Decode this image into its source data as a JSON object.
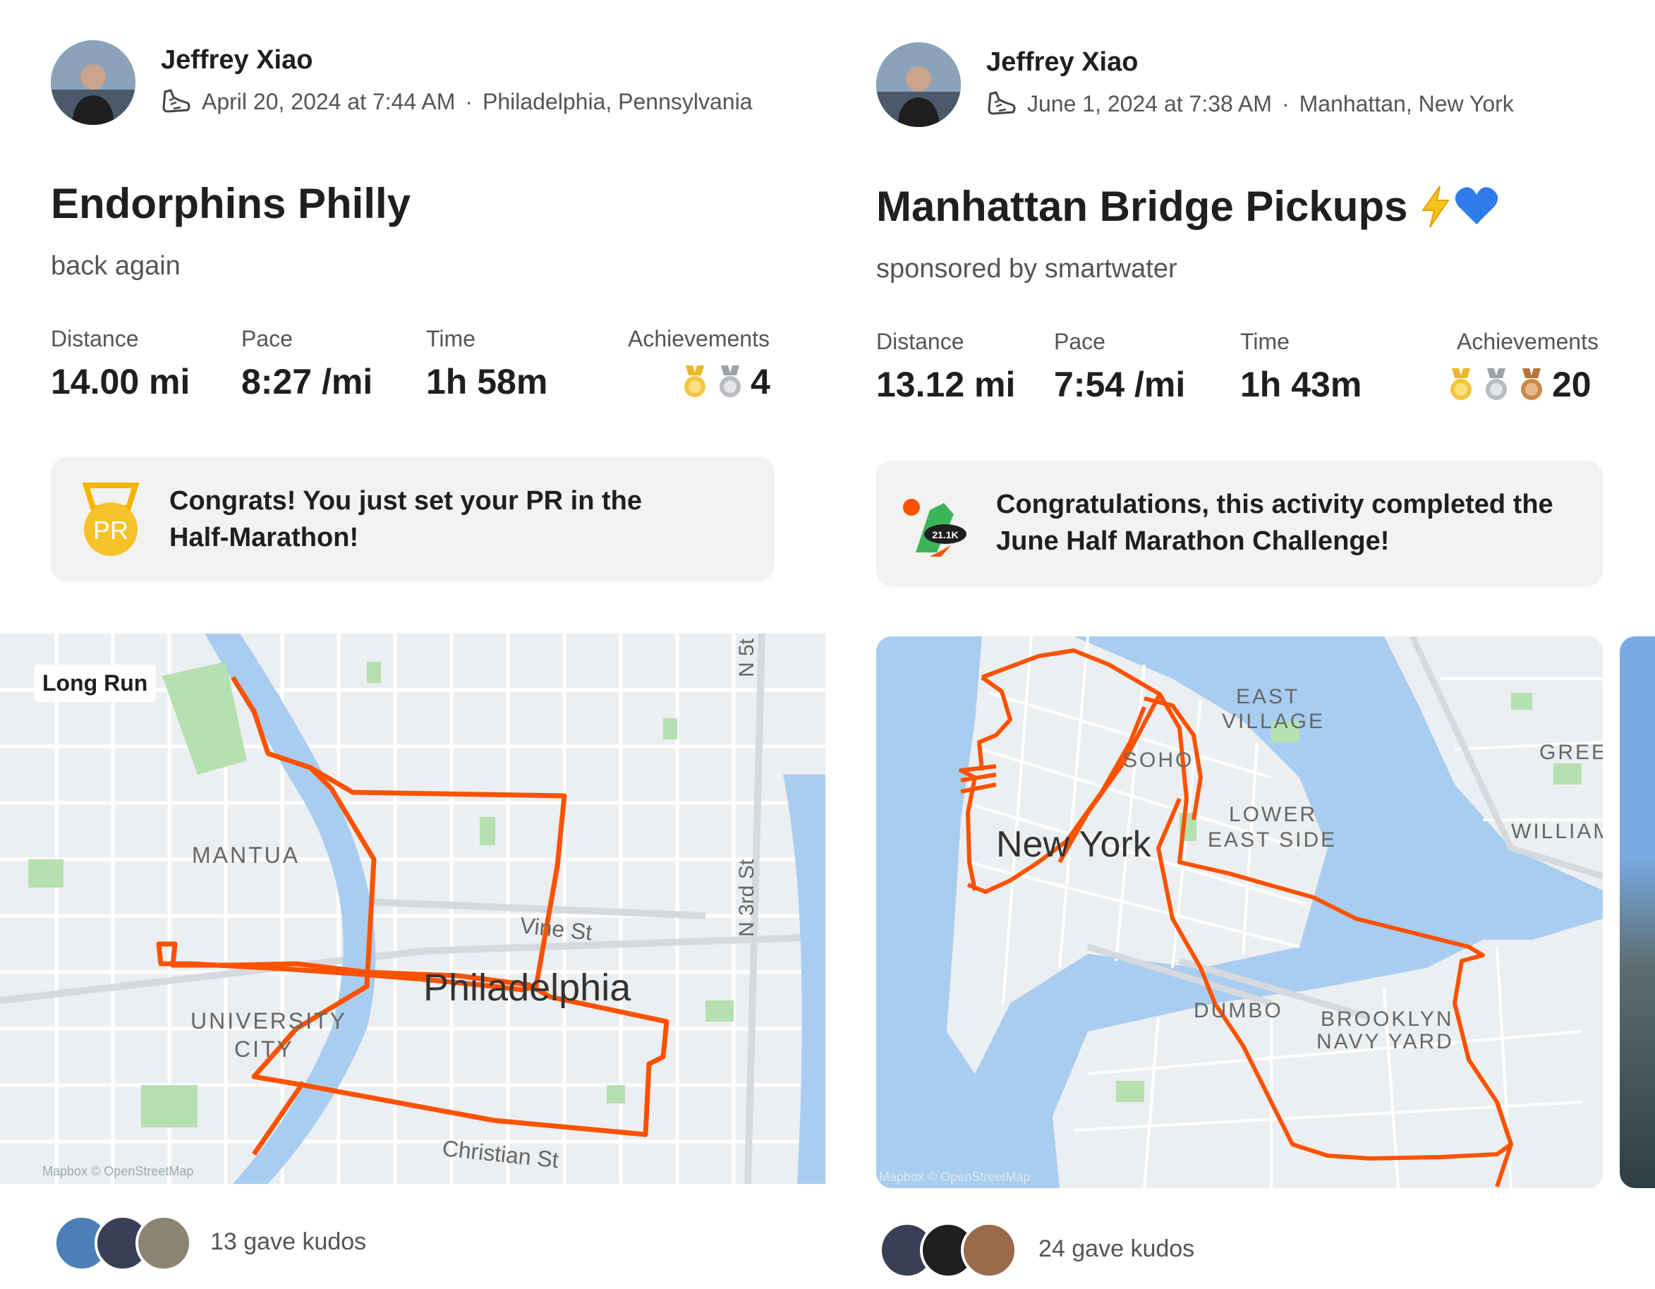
{
  "activities": [
    {
      "athlete": "Jeffrey Xiao",
      "date": "April 20, 2024 at 7:44 AM",
      "location": "Philadelphia, Pennsylvania",
      "separator": "·",
      "title": "Endorphins Philly",
      "title_emoji": "",
      "description": "back again",
      "stats": {
        "distance_label": "Distance",
        "distance_value": "14.00 mi",
        "pace_label": "Pace",
        "pace_value": "8:27 /mi",
        "time_label": "Time",
        "time_value": "1h 58m",
        "achievements_label": "Achievements",
        "achievements_count": "4"
      },
      "medals": [
        "gold",
        "silver"
      ],
      "banner": {
        "icon": "pr-medal-icon",
        "icon_text": "PR",
        "line1": "Congrats! You just set your PR in the",
        "line2": "Half-Marathon!"
      },
      "map": {
        "tag": "Long Run",
        "labels": [
          "MANTUA",
          "UNIVERSITY",
          "CITY",
          "Vine St",
          "Philadelphia",
          "N 3rd St",
          "N 5t",
          "Christian St",
          "Mapbox © OpenStreetMap"
        ],
        "route_color": "#fc5200"
      },
      "kudos": "13 gave kudos"
    },
    {
      "athlete": "Jeffrey Xiao",
      "date": "June 1, 2024 at 7:38 AM",
      "location": "Manhattan, New York",
      "separator": "·",
      "title": "Manhattan Bridge Pickups",
      "title_emoji": "⚡💙",
      "description": "sponsored by smartwater",
      "stats": {
        "distance_label": "Distance",
        "distance_value": "13.12 mi",
        "pace_label": "Pace",
        "pace_value": "7:54 /mi",
        "time_label": "Time",
        "time_value": "1h 43m",
        "achievements_label": "Achievements",
        "achievements_count": "20"
      },
      "medals": [
        "gold",
        "silver",
        "bronze"
      ],
      "banner": {
        "icon": "challenge-badge-icon",
        "icon_text": "21.1K",
        "line1": "Congratulations, this activity completed the",
        "line2": "June Half Marathon Challenge!"
      },
      "map": {
        "labels": [
          "EAST",
          "VILLAGE",
          "SOHO",
          "LOWER",
          "EAST SIDE",
          "New York",
          "GREE",
          "WILLIAM",
          "DUMBO",
          "BROOKLYN",
          "NAVY YARD",
          "Mapbox © OpenStreetMap"
        ],
        "route_color": "#fc5200"
      },
      "kudos": "24 gave kudos"
    }
  ],
  "colors": {
    "route": "#fc5200",
    "water": "#a9cdf0",
    "land": "#eceff1",
    "park": "#b5e0b0",
    "gold": "#f4c542",
    "silver": "#b8bcc0",
    "bronze": "#c98a4b"
  }
}
